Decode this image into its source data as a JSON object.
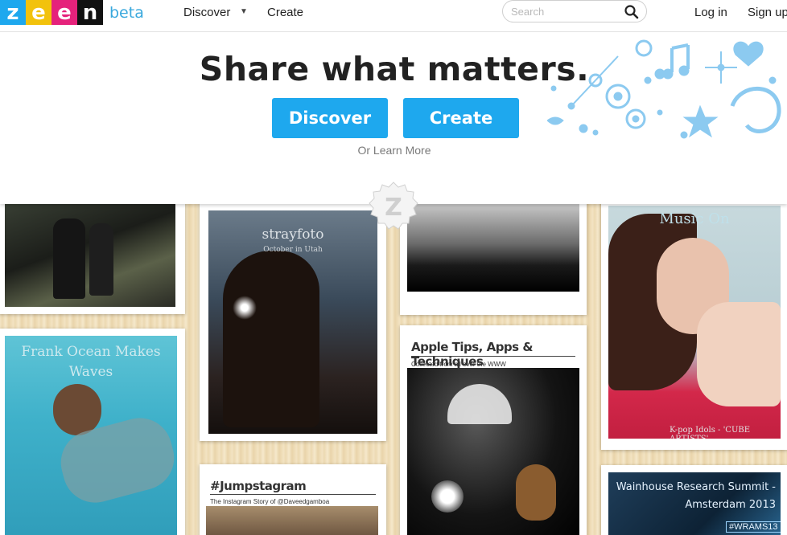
{
  "header": {
    "logo_letters": [
      {
        "char": "z",
        "color": "#1ea8ee"
      },
      {
        "char": "e",
        "color": "#f2c20c"
      },
      {
        "char": "e",
        "color": "#e5227b"
      },
      {
        "char": "n",
        "color": "#111111"
      }
    ],
    "beta_label": "beta",
    "nav": {
      "discover": "Discover",
      "create": "Create"
    },
    "search_placeholder": "Search",
    "login": "Log in",
    "signup": "Sign up"
  },
  "hero": {
    "headline": "Share what matters.",
    "discover_button": "Discover",
    "create_button": "Create",
    "learn_more": "Or Learn More"
  },
  "feed": {
    "strayfoto_title": "strayfoto",
    "strayfoto_subtitle": "October in Utah",
    "music_title": "Music On",
    "music_caption": "K-pop Idols - 'CUBE ARTISTS'",
    "frank_title": "Frank Ocean Makes Waves",
    "apple_title": "Apple Tips, Apps & Techniques",
    "apple_subtitle": "Collected from all over the WWW",
    "jump_title": "#Jumpstagram",
    "jump_subtitle": "The Instagram Story of @Daveedgamboa",
    "wainhouse_title": "Wainhouse Research Summit - Amsterdam 2013",
    "wainhouse_tag": "#WRAMS13"
  },
  "colors": {
    "accent": "#1ea8ee",
    "wood": "#f0dfbd",
    "text": "#222222"
  }
}
